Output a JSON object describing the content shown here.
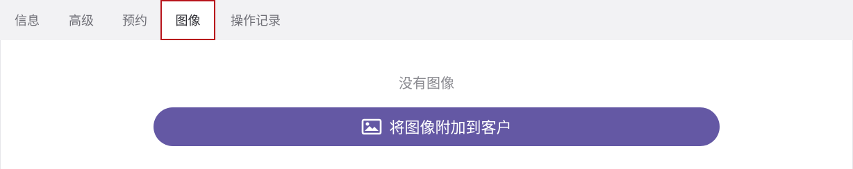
{
  "tabs": [
    {
      "label": "信息"
    },
    {
      "label": "高级"
    },
    {
      "label": "预约"
    },
    {
      "label": "图像",
      "active": true
    },
    {
      "label": "操作记录"
    }
  ],
  "content": {
    "empty_message": "没有图像",
    "attach_button_label": "将图像附加到客户",
    "attach_button_icon": "image-icon"
  },
  "colors": {
    "tabbar_bg": "#f2f2f4",
    "active_tab_border": "#b8141b",
    "button_bg": "#6458a4",
    "button_text": "#ffffff",
    "muted_text": "#8a8a90"
  }
}
